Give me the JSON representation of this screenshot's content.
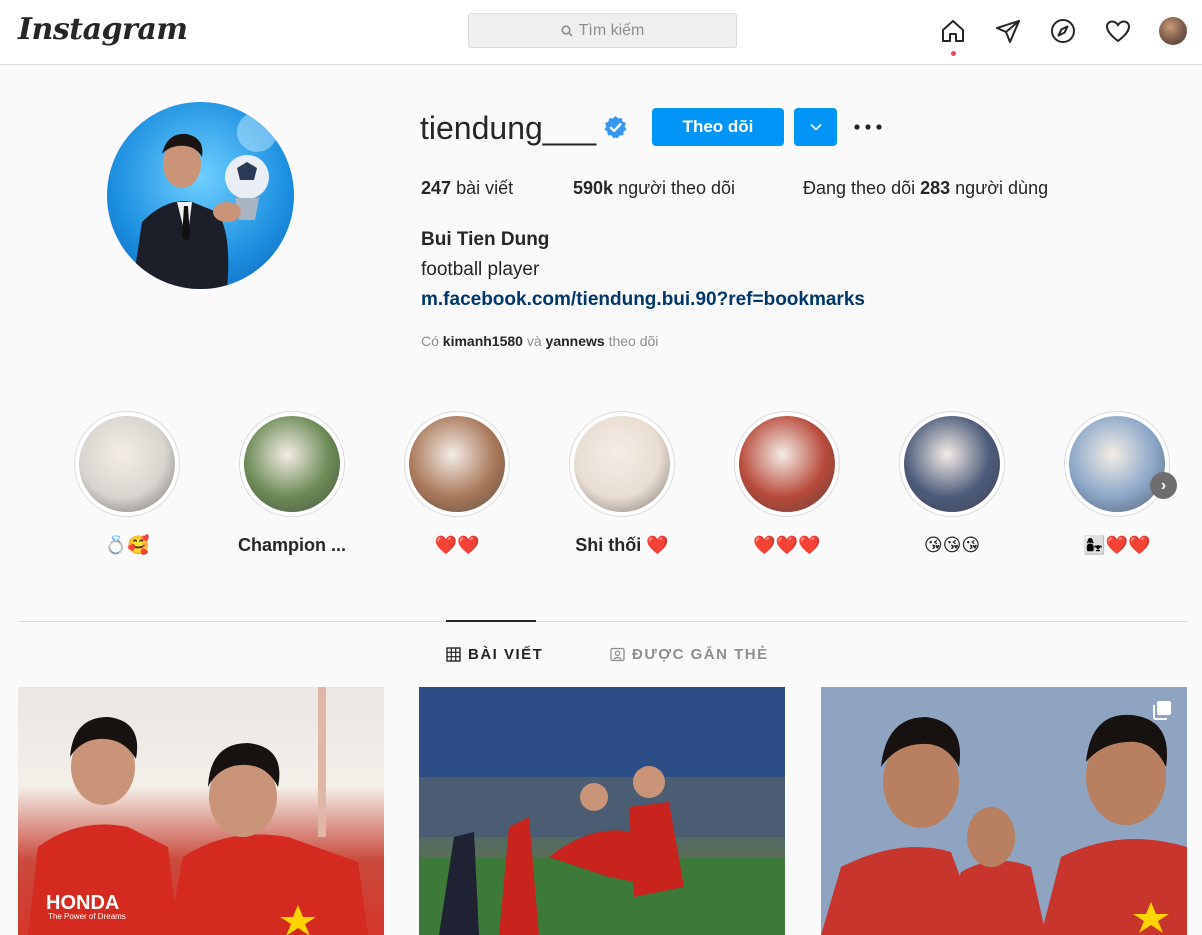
{
  "nav": {
    "logo": "Instagram",
    "search_placeholder": "Tìm kiếm"
  },
  "profile": {
    "username": "tiendung___",
    "follow_label": "Theo dõi",
    "stats": {
      "posts_num": "247",
      "posts_label": "bài viết",
      "followers_num": "590k",
      "followers_label": "người theo dõi",
      "following_prefix": "Đang theo dõi",
      "following_num": "283",
      "following_label": "người dùng"
    },
    "full_name": "Bui Tien Dung",
    "bio": "football player",
    "link": "m.facebook.com/tiendung.bui.90?ref=bookmarks",
    "followed_by": {
      "prefix": "Có",
      "user1": "kimanh1580",
      "and": "và",
      "user2": "yannews",
      "suffix": "theo dõi"
    }
  },
  "highlights": [
    {
      "label": "💍🥰",
      "color": "#d8d4cf"
    },
    {
      "label": "Champion ...",
      "color": "#6b8a55"
    },
    {
      "label": "❤️❤️",
      "color": "#a9785a"
    },
    {
      "label": "Shi thối ❤️",
      "color": "#e9ddd2"
    },
    {
      "label": "❤️❤️❤️",
      "color": "#b84a3a"
    },
    {
      "label": "😘😘😘",
      "color": "#4c5b7a"
    },
    {
      "label": "👩‍👧❤️❤️",
      "color": "#8aa6c8"
    }
  ],
  "tabs": {
    "posts": "BÀI VIẾT",
    "tagged": "ĐƯỢC GẮN THẺ"
  },
  "posts": [
    {
      "caption_visible": "HONDA",
      "sub": "The Power of Dreams"
    },
    {
      "caption_visible": ""
    },
    {
      "caption_visible": ""
    }
  ]
}
